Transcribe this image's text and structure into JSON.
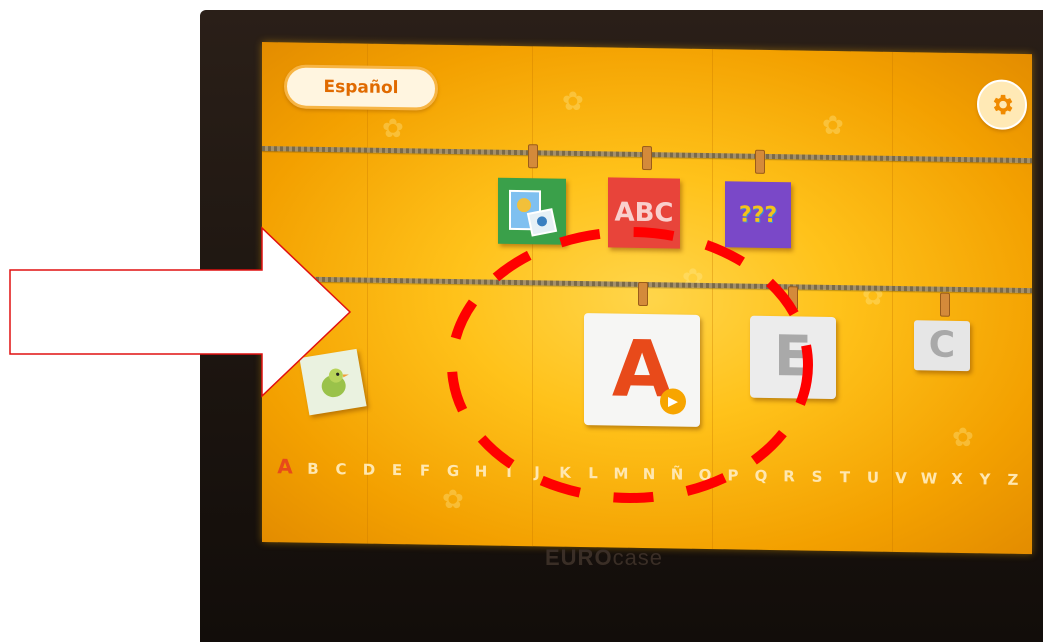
{
  "app": {
    "language_button": "Español",
    "settings_icon": "gear-icon"
  },
  "activities": [
    {
      "name": "games",
      "icon": "picture-cards-icon"
    },
    {
      "name": "abc",
      "icon": "abc-letters-icon",
      "text": "ABC"
    },
    {
      "name": "quiz",
      "icon": "question-cards-icon",
      "text": "???"
    }
  ],
  "letter_cards": [
    {
      "letter": "A",
      "selected": true,
      "color": "#e84a1a"
    },
    {
      "letter": "E",
      "color": "#a9a9a9"
    },
    {
      "letter": "C",
      "color": "#a9a9a9"
    }
  ],
  "alphabet": [
    "A",
    "B",
    "C",
    "D",
    "E",
    "F",
    "G",
    "H",
    "I",
    "J",
    "K",
    "L",
    "M",
    "N",
    "Ñ",
    "O",
    "P",
    "Q",
    "R",
    "S",
    "T",
    "U",
    "V",
    "W",
    "X",
    "Y",
    "Z"
  ],
  "alphabet_selected": "A",
  "device_brand": {
    "bold": "EURO",
    "light": "case"
  },
  "annotation": {
    "arrow_color": "#e01010",
    "circle_color": "#ff0000"
  }
}
